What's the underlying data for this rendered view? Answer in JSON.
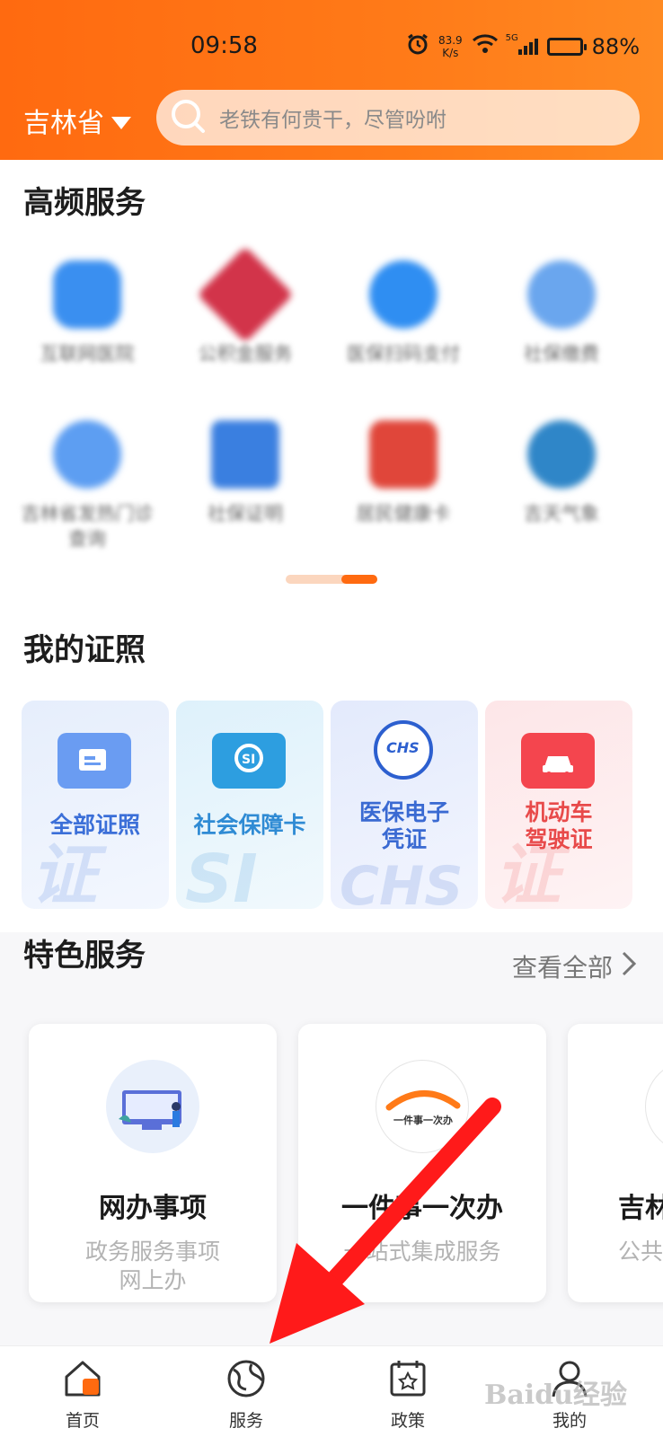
{
  "status_bar": {
    "time": "09:58",
    "net_speed_value": "83.9",
    "net_speed_unit": "K/s",
    "network": "5G",
    "battery": "88%",
    "battery_level": 0.88
  },
  "header": {
    "region": "吉林省",
    "search_placeholder": "老铁有何贵干，尽管吩咐",
    "accent_color": "#ff6a10"
  },
  "high_freq": {
    "title": "高频服务",
    "items": [
      {
        "icon": "cloud-hospital-icon",
        "label": "互联网医院",
        "color": "#3a8ff0"
      },
      {
        "icon": "housing-fund-icon",
        "label": "公积金服务",
        "color": "#d2344a"
      },
      {
        "icon": "medical-scan-pay-icon",
        "label": "医保扫码支付",
        "color": "#2f8ef2"
      },
      {
        "icon": "social-payment-icon",
        "label": "社保缴费",
        "color": "#6aa6ee"
      },
      {
        "icon": "hotline-icon",
        "label": "吉林省发热门诊查询",
        "color": "#5d9ef2"
      },
      {
        "icon": "social-certificate-icon",
        "label": "社保证明",
        "color": "#3a7fe0"
      },
      {
        "icon": "health-card-icon",
        "label": "居民健康卡",
        "color": "#e0463a"
      },
      {
        "icon": "weather-icon",
        "label": "吉天气象",
        "color": "#2f86c8"
      }
    ]
  },
  "licenses": {
    "title": "我的证照",
    "cards": [
      {
        "label": "全部证照",
        "text_color": "#3b6fd8",
        "bg": "#e4edfb",
        "icon": "document-card-icon",
        "icon_color": "#4a86f0",
        "wm": "证"
      },
      {
        "label": "社会保障卡",
        "text_color": "#2f8bd4",
        "bg": "#e2f2fb",
        "icon": "social-security-card-icon",
        "icon_color": "#2d9ee0",
        "wm": "SI"
      },
      {
        "label": "医保电子凭证",
        "label_line2": "凭证",
        "label_line1": "医保电子",
        "text_color": "#3a6ad2",
        "bg": "#e6ecfb",
        "icon": "chs-medical-icon",
        "icon_color": "#2c5fcf",
        "wm": "CHS"
      },
      {
        "label": "机动车驾驶证",
        "label_line1": "机动车",
        "label_line2": "驾驶证",
        "text_color": "#e84a4a",
        "bg": "#fde9ea",
        "icon": "car-license-icon",
        "icon_color": "#f4454e",
        "wm": "证"
      }
    ]
  },
  "featured": {
    "title": "特色服务",
    "view_all": "查看全部",
    "cards": [
      {
        "icon": "online-affairs-icon",
        "title": "网办事项",
        "sub1": "政务服务事项",
        "sub2": "网上办"
      },
      {
        "icon": "one-thing-icon",
        "title": "一件事一次办",
        "logo_text": "一件事一次办",
        "sub1": "一站式集成服务",
        "sub2": ""
      },
      {
        "icon": "jilin-public-icon",
        "title": "吉林",
        "sub1": "公共",
        "sub2": ""
      }
    ]
  },
  "tabbar": {
    "tabs": [
      {
        "label": "首页",
        "icon": "home-icon"
      },
      {
        "label": "服务",
        "icon": "globe-icon"
      },
      {
        "label": "政策",
        "icon": "policy-calendar-icon"
      },
      {
        "label": "我的",
        "icon": "user-icon"
      }
    ]
  },
  "overlay": {
    "arrow_color": "#ff1a1a",
    "watermark": "Baidu经验"
  }
}
